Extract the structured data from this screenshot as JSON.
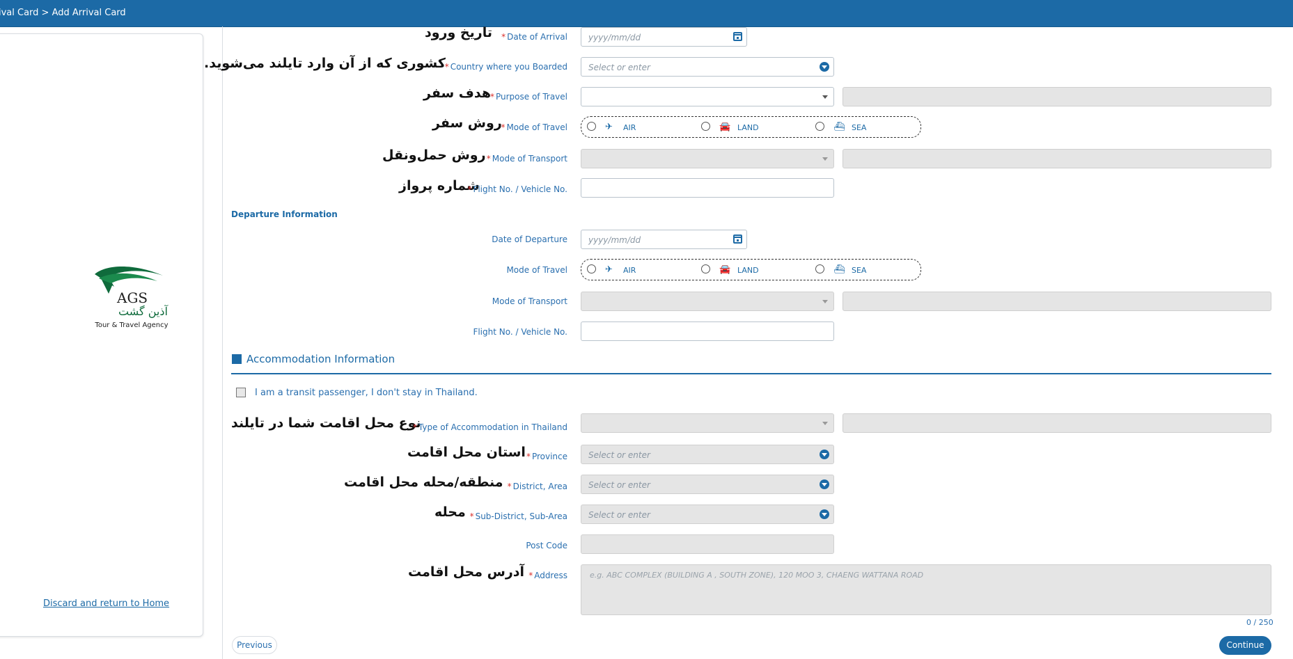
{
  "topbar": {
    "breadcrumb": "ival Card > Add Arrival Card"
  },
  "sidebar": {
    "logo": {
      "brand": "AGS",
      "persian_name": "آذین گشت",
      "tagline": "Tour & Travel Agency"
    },
    "discard_link": "Discard and return to Home"
  },
  "arrival": {
    "date": {
      "fa": "تاریخ ورود",
      "en": "Date of Arrival",
      "required": true,
      "placeholder": "yyyy/mm/dd"
    },
    "country": {
      "fa": "کشوری که از آن وارد تایلند می‌شوید.",
      "en": "Country where you Boarded",
      "required": true,
      "placeholder": "Select or enter"
    },
    "purpose": {
      "fa": "هدف سفر",
      "en": "Purpose of Travel",
      "required": true
    },
    "mode_travel": {
      "fa": "روش سفر",
      "en": "Mode of Travel",
      "required": true
    },
    "mode_transport": {
      "fa": "روش حمل‌ونقل",
      "en": "Mode of Transport",
      "required": true
    },
    "flight": {
      "fa": "شماره پرواز",
      "en": "Flight No. / Vehicle No.",
      "required": true
    }
  },
  "travel_modes": {
    "air": "AIR",
    "land": "LAND",
    "sea": "SEA"
  },
  "departure": {
    "section_title": "Departure Information",
    "date": {
      "en": "Date of Departure",
      "placeholder": "yyyy/mm/dd"
    },
    "mode_travel": {
      "en": "Mode of Travel"
    },
    "mode_transport": {
      "en": "Mode of Transport"
    },
    "flight": {
      "en": "Flight No. / Vehicle No."
    }
  },
  "accommodation": {
    "section_title": "Accommodation Information",
    "transit_checkbox": "I am a transit passenger, I don't stay in Thailand.",
    "type": {
      "fa": "نوع محل اقامت شما در تایلند",
      "en": "Type of Accommodation in Thailand",
      "required": true
    },
    "province": {
      "fa": "استان محل اقامت",
      "en": "Province",
      "required": true,
      "placeholder": "Select or enter"
    },
    "district": {
      "fa": "منطقه/محله محل اقامت",
      "en": "District, Area",
      "required": true,
      "placeholder": "Select or enter"
    },
    "subdistrict": {
      "fa": "محله",
      "en": "Sub-District, Sub-Area",
      "required": true,
      "placeholder": "Select or enter"
    },
    "postcode": {
      "en": "Post Code"
    },
    "address": {
      "fa": "آدرس محل اقامت",
      "en": "Address",
      "required": true,
      "placeholder": "e.g. ABC COMPLEX (BUILDING A , SOUTH ZONE), 120 MOO 3, CHAENG WATTANA ROAD",
      "counter": "0 / 250"
    }
  },
  "nav": {
    "previous": "Previous",
    "continue": "Continue"
  },
  "colors": {
    "brand_blue": "#1c6aa6",
    "required_red": "#d9302c",
    "disabled_gray": "#e5e5e5"
  }
}
